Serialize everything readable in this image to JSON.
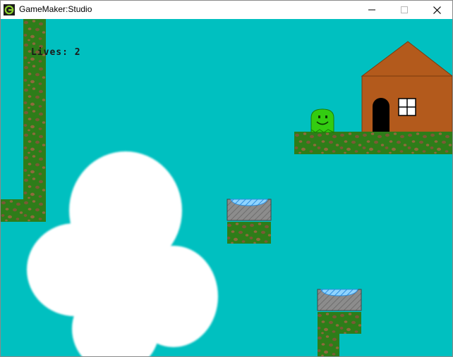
{
  "window": {
    "title": "GameMaker:Studio",
    "icon": "gamemaker-icon",
    "controls": [
      "minimize-icon",
      "maximize-icon",
      "close-icon"
    ]
  },
  "hud": {
    "lives_label": "Lives:",
    "lives_value": "2"
  },
  "colors": {
    "sky": "#00c0c0",
    "grass": "#2e7d19",
    "grass_dots": "#7a5a34",
    "house_wall": "#b35a1c",
    "house_roof": "#b35a1c",
    "door": "#000000",
    "player": "#33cc11",
    "spring_top": "#4fb3ff",
    "spring_base": "#8a8a8a",
    "cloud": "#ffffff"
  },
  "scene": {
    "player": "slime-player-icon",
    "house": "house-icon",
    "springs": [
      "spring-pad-icon",
      "spring-pad-icon"
    ],
    "cloud": "cloud-icon"
  }
}
